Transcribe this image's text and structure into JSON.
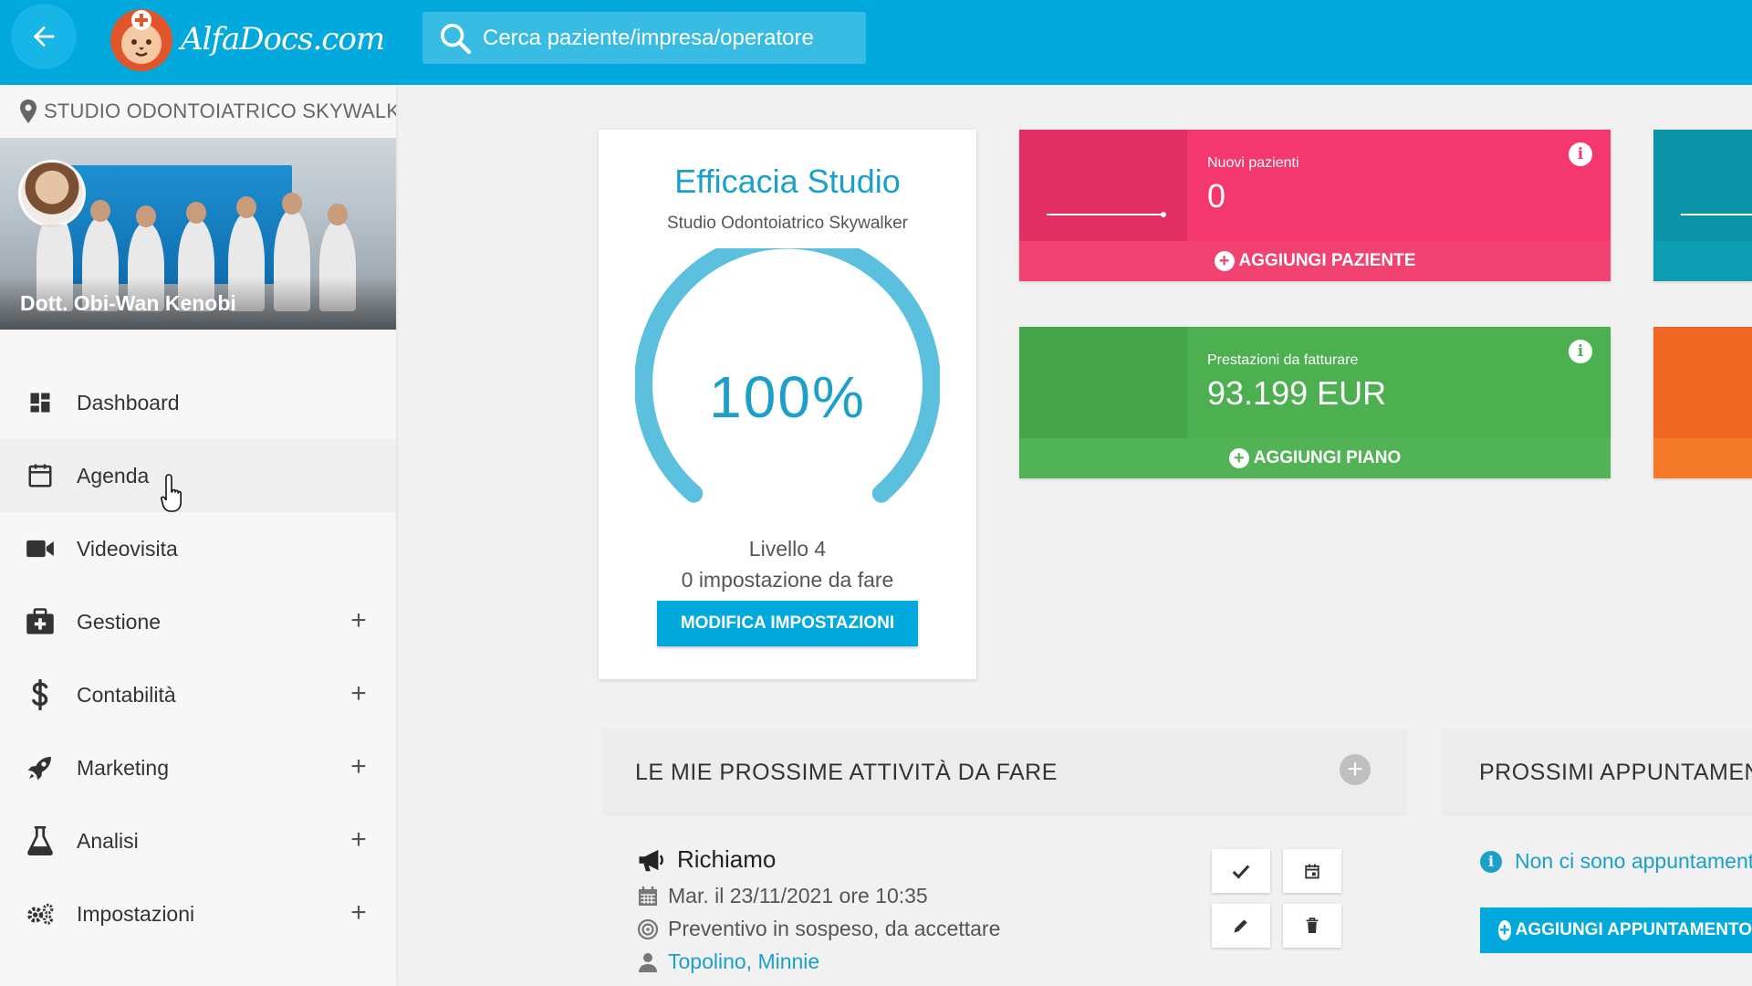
{
  "header": {
    "logo_text": "AlfaDocs.com",
    "search_placeholder": "Cerca paziente/impresa/operatore"
  },
  "sidebar": {
    "studio_name": "STUDIO ODONTOIATRICO SKYWALKER",
    "profile_name": "Dott. Obi-Wan Kenobi",
    "items": [
      {
        "label": "Dashboard",
        "icon": "dashboard-icon",
        "expandable": false
      },
      {
        "label": "Agenda",
        "icon": "calendar-icon",
        "expandable": false
      },
      {
        "label": "Videovisita",
        "icon": "video-camera-icon",
        "expandable": false
      },
      {
        "label": "Gestione",
        "icon": "medical-kit-icon",
        "expandable": true
      },
      {
        "label": "Contabilità",
        "icon": "dollar-icon",
        "expandable": true
      },
      {
        "label": "Marketing",
        "icon": "rocket-icon",
        "expandable": true
      },
      {
        "label": "Analisi",
        "icon": "flask-icon",
        "expandable": true
      },
      {
        "label": "Impostazioni",
        "icon": "gears-icon",
        "expandable": true
      }
    ]
  },
  "efficacia": {
    "title": "Efficacia Studio",
    "subtitle": "Studio Odontoiatrico Skywalker",
    "percent": 100,
    "percent_label": "100%",
    "level": "Livello 4",
    "todo": "0 impostazione da fare",
    "button": "MODIFICA IMPOSTAZIONI",
    "color": "#1aa0c9"
  },
  "stats": {
    "new_patients": {
      "label": "Nuovi pazienti",
      "value": "0",
      "action": "AGGIUNGI PAZIENTE",
      "color": "#f5376f"
    },
    "to_invoice": {
      "label": "Prestazioni da fatturare",
      "value": "93.199 EUR",
      "action": "AGGIUNGI PIANO",
      "color": "#4caf50"
    }
  },
  "tasks": {
    "title": "LE MIE PROSSIME ATTIVITÀ DA FARE",
    "items": [
      {
        "title": "Richiamo",
        "date": "Mar. il 23/11/2021 ore 10:35",
        "description": "Preventivo in sospeso, da accettare",
        "patient": "Topolino, Minnie"
      }
    ]
  },
  "appointments": {
    "title": "PROSSIMI APPUNTAMENTI",
    "empty_message": "Non ci sono appuntamenti",
    "button": "AGGIUNGI APPUNTAMENTO"
  }
}
